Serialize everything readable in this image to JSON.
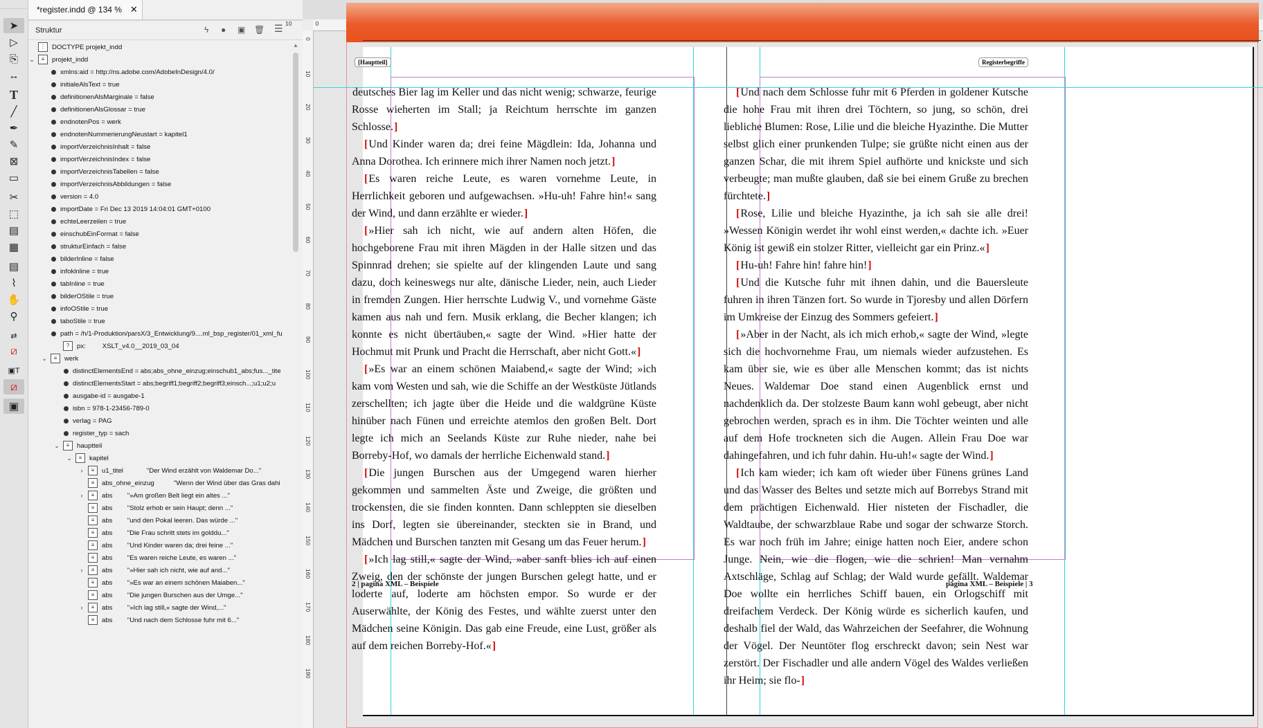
{
  "document": {
    "tab_title": "*register.indd @ 134 %",
    "close_glyph": "✕"
  },
  "panel": {
    "title": "Struktur",
    "rows": [
      {
        "level": 0,
        "kind": "doctype",
        "text": "DOCTYPE projekt_indd"
      },
      {
        "level": 0,
        "kind": "element",
        "twisty": "open",
        "text": "projekt_indd"
      },
      {
        "level": 1,
        "kind": "attr",
        "text": "xmlns:aid = http://ns.adobe.com/AdobeInDesign/4.0/"
      },
      {
        "level": 1,
        "kind": "attr",
        "text": "initialeAlsText = true"
      },
      {
        "level": 1,
        "kind": "attr",
        "text": "definitionenAlsMarginale = false"
      },
      {
        "level": 1,
        "kind": "attr",
        "text": "definitionenAlsGlossar = true"
      },
      {
        "level": 1,
        "kind": "attr",
        "text": "endnotenPos = werk"
      },
      {
        "level": 1,
        "kind": "attr",
        "text": "endnotenNummerierungNeustart = kapitel1"
      },
      {
        "level": 1,
        "kind": "attr",
        "text": "importVerzeichnisInhalt = false"
      },
      {
        "level": 1,
        "kind": "attr",
        "text": "importVerzeichnisIndex = false"
      },
      {
        "level": 1,
        "kind": "attr",
        "text": "importVerzeichnisTabellen = false"
      },
      {
        "level": 1,
        "kind": "attr",
        "text": "importVerzeichnisAbbildungen = false"
      },
      {
        "level": 1,
        "kind": "attr",
        "text": "version = 4.0"
      },
      {
        "level": 1,
        "kind": "attr",
        "text": "importDate = Fri Dec 13 2019 14:04:01 GMT+0100"
      },
      {
        "level": 1,
        "kind": "attr",
        "text": "echteLeerzeilen = true"
      },
      {
        "level": 1,
        "kind": "attr",
        "text": "einschubEinFormat = false"
      },
      {
        "level": 1,
        "kind": "attr",
        "text": "strukturEinfach = false"
      },
      {
        "level": 1,
        "kind": "attr",
        "text": "bilderInline = false"
      },
      {
        "level": 1,
        "kind": "attr",
        "text": "infoklnline = true"
      },
      {
        "level": 1,
        "kind": "attr",
        "text": "tabInline = true"
      },
      {
        "level": 1,
        "kind": "attr",
        "text": "bilderOStile = true"
      },
      {
        "level": 1,
        "kind": "attr",
        "text": "infoOStile = true"
      },
      {
        "level": 1,
        "kind": "attr",
        "text": "taboStile = true"
      },
      {
        "level": 1,
        "kind": "attr",
        "text": "path = /h/1-Produktion/parsX/3_Entwicklung/9....ml_bsp_register/01_xml_fu"
      },
      {
        "level": 2,
        "kind": "pi",
        "text": "px:",
        "snippet": "XSLT_v4.0__2019_03_04"
      },
      {
        "level": 1,
        "kind": "element",
        "twisty": "open",
        "text": "werk"
      },
      {
        "level": 2,
        "kind": "attr",
        "text": "distinctElementsEnd = abs;abs_ohne_einzug;einschub1_abs;fus..._tite"
      },
      {
        "level": 2,
        "kind": "attr",
        "text": "distinctElementsStart = abs;begriff1;begriff2;begriff3;einsch...;u1;u2;u"
      },
      {
        "level": 2,
        "kind": "attr",
        "text": "ausgabe-id = ausgabe-1"
      },
      {
        "level": 2,
        "kind": "attr",
        "text": "isbn = 978-1-23456-789-0"
      },
      {
        "level": 2,
        "kind": "attr",
        "text": "verlag = PAG"
      },
      {
        "level": 2,
        "kind": "attr",
        "text": "register_typ = sach"
      },
      {
        "level": 2,
        "kind": "element",
        "twisty": "open",
        "text": "hauptteil"
      },
      {
        "level": 3,
        "kind": "element",
        "twisty": "open",
        "text": "kapitel"
      },
      {
        "level": 4,
        "kind": "element",
        "twisty": "closed",
        "text": "u1_titel",
        "snippet": "\"Der Wind erzählt von Waldemar Do...\""
      },
      {
        "level": 4,
        "kind": "element",
        "text": "abs_ohne_einzug",
        "snippet": "\"Wenn der Wind über das Gras dahi"
      },
      {
        "level": 4,
        "kind": "element",
        "twisty": "closed",
        "text": "abs",
        "snippet": "\"»Am großen Belt liegt ein altes ...\""
      },
      {
        "level": 4,
        "kind": "element",
        "text": "abs",
        "snippet": "\"Stolz erhob er sein Haupt; denn ...\""
      },
      {
        "level": 4,
        "kind": "element",
        "text": "abs",
        "snippet": "\"und den Pokal leeren. Das würde ...\""
      },
      {
        "level": 4,
        "kind": "element",
        "text": "abs",
        "snippet": "\"Die Frau schritt stets im golddu...\""
      },
      {
        "level": 4,
        "kind": "element",
        "text": "abs",
        "snippet": "\"Und Kinder waren da; drei feine ...\""
      },
      {
        "level": 4,
        "kind": "element",
        "text": "abs",
        "snippet": "\"Es waren reiche Leute, es waren ...\""
      },
      {
        "level": 4,
        "kind": "element",
        "twisty": "closed",
        "text": "abs",
        "snippet": "\"»Hier sah ich nicht, wie auf and...\""
      },
      {
        "level": 4,
        "kind": "element",
        "text": "abs",
        "snippet": "\"»Es war an einem schönen Maiaben...\""
      },
      {
        "level": 4,
        "kind": "element",
        "text": "abs",
        "snippet": "\"Die jungen Burschen aus der Umge...\""
      },
      {
        "level": 4,
        "kind": "element",
        "twisty": "closed",
        "text": "abs",
        "snippet": "\"»Ich lag still,« sagte der Wind,...\""
      },
      {
        "level": 4,
        "kind": "element",
        "text": "abs",
        "snippet": "\"Und nach dem Schlosse fuhr mit 6...\""
      }
    ]
  },
  "ruler": {
    "h_labels_left": [
      "10",
      "0",
      "10",
      "20",
      "30",
      "40",
      "50",
      "60",
      "70",
      "80",
      "90",
      "100",
      "110",
      "120"
    ],
    "h_labels_right": [
      "10",
      "0",
      "10",
      "20",
      "30",
      "40",
      "50",
      "60",
      "70",
      "80",
      "90",
      "100",
      "110",
      "120"
    ],
    "v_labels": [
      "0",
      "10",
      "20",
      "30",
      "40",
      "50",
      "60",
      "70",
      "80",
      "90",
      "100",
      "110",
      "120",
      "130",
      "140",
      "150",
      "160",
      "170",
      "180",
      "190"
    ]
  },
  "page_left": {
    "header_tag": "[Hauptteil]",
    "paragraphs": [
      {
        "first": true,
        "text": "deutsches Bier lag im Keller und das nicht wenig; schwarze, feurige Rosse wieherten im Stall; ja Reichtum herrschte im ganzen Schlosse."
      },
      {
        "text": "Und Kinder waren da; drei feine Mägdlein: Ida, Johanna und Anna Dorothea. Ich erinnere mich ihrer Namen noch jetzt."
      },
      {
        "text": "Es waren reiche Leute, es waren vornehme Leute, in Herrlichkeit geboren und aufgewachsen. »Hu-uh! Fahre hin!« sang der Wind, und dann erzählte er wieder."
      },
      {
        "text": "»Hier sah ich nicht, wie auf andern alten Höfen, die hochgeborene Frau mit ihren Mägden in der Halle sitzen und das Spinnrad drehen; sie spielte auf der klingenden Laute und sang dazu, doch keineswegs nur alte, dänische Lieder, nein, auch Lieder in fremden Zungen. Hier herrschte Ludwig V., und vornehme Gäste kamen aus nah und fern. Musik erklang, die Becher klangen; ich konnte es nicht übertäuben,« sagte der Wind. »Hier hatte der Hochmut mit Prunk und Pracht die Herrschaft, aber nicht Gott.«"
      },
      {
        "text": "»Es war an einem schönen Maiabend,« sagte der Wind; »ich kam vom Westen und sah, wie die Schiffe an der Westküste Jütlands zerschellten; ich jagte über die Heide und die waldgrüne Küste hinüber nach Fünen und erreichte atemlos den großen Belt. Dort legte ich mich an Seelands Küste zur Ruhe nieder, nahe bei Borreby-Hof, wo damals der herrliche Eichenwald stand."
      },
      {
        "text": "Die jungen Burschen aus der Umgegend waren hierher gekommen und sammelten Äste und Zweige, die größten und trockensten, die sie finden konnten. Dann schleppten sie dieselben ins Dorf, legten sie übereinander, steckten sie in Brand, und Mädchen und Burschen tanzten mit Gesang um das Feuer herum."
      },
      {
        "text": "»Ich lag still,« sagte der Wind, »aber sanft blies ich auf einen Zweig, den der schönste der jungen Burschen gelegt hatte, und er loderte auf, loderte am höchsten empor. So wurde er der Auserwählte, der König des Festes, und wählte zuerst unter den Mädchen seine Königin. Das gab eine Freude, eine Lust, größer als auf dem reichen Borreby-Hof.«"
      }
    ],
    "folio": "2 | pagina XML – Beispiele"
  },
  "page_right": {
    "header_tag": "Registerbegriffe",
    "paragraphs": [
      {
        "text": "Und nach dem Schlosse fuhr mit 6 Pferden in goldener Kutsche die hohe Frau mit ihren drei Töchtern, so jung, so schön, drei liebliche Blumen: Rose, Lilie und die bleiche Hyazinthe. Die Mutter selbst glich einer prunkenden Tulpe; sie grüßte nicht einen aus der ganzen Schar, die mit ihrem Spiel aufhörte und knickste und sich verbeugte; man mußte glauben, daß sie bei einem Gruße zu brechen fürchtete."
      },
      {
        "text": "Rose, Lilie und bleiche Hyazinthe, ja ich sah sie alle drei! »Wessen Königin werdet ihr wohl einst werden,« dachte ich. »Euer König ist gewiß ein stolzer Ritter, vielleicht gar ein Prinz.«"
      },
      {
        "text": "Hu-uh! Fahre hin! fahre hin!"
      },
      {
        "text": "Und die Kutsche fuhr mit ihnen dahin, und die Bauersleute fuhren in ihren Tänzen fort. So wurde in Tjoresby und allen Dörfern im Umkreise der Einzug des Sommers gefeiert."
      },
      {
        "text": "»Aber in der Nacht, als ich mich erhob,« sagte der Wind, »legte sich die hochvornehme Frau, um niemals wieder aufzustehen. Es kam über sie, wie es über alle Menschen kommt; das ist nichts Neues. Waldemar Doe stand einen Augenblick ernst und nachdenklich da. Der stolzeste Baum kann wohl gebeugt, aber nicht gebrochen werden, sprach es in ihm. Die Töchter weinten und alle auf dem Hofe trockneten sich die Augen. Allein Frau Doe war dahingefahren, und ich fuhr dahin. Hu-uh!« sagte der Wind."
      },
      {
        "text": "Ich kam wieder; ich kam oft wieder über Fünens grünes Land und das Wasser des Beltes und setzte mich auf Borrebys Strand mit dem prächtigen Eichenwald. Hier nisteten der Fischadler, die Waldtaube, der schwarzblaue Rabe und sogar der schwarze Storch. Es war noch früh im Jahre; einige hatten noch Eier, andere schon Junge. Nein, wie die flogen, wie die schrien! Man vernahm Axtschläge, Schlag auf Schlag; der Wald wurde gefällt. Waldemar Doe wollte ein herrliches Schiff bauen, ein Orlogschiff mit dreifachem Verdeck. Der König würde es sicherlich kaufen, und deshalb fiel der Wald, das Wahrzeichen der Seefahrer, die Wohnung der Vögel. Der Neuntöter flog erschreckt davon; sein Nest war zerstört. Der Fischadler und alle andern Vögel des Waldes verließen ihr Heim; sie flo-"
      }
    ],
    "folio": "pagina XML – Beispiele | 3"
  },
  "colors": {
    "header_band": "#ea5a28",
    "guide": "#33d7d2",
    "margin": "#c07ccc",
    "bleed": "#e8909a",
    "tag_bracket": "#d01010"
  }
}
